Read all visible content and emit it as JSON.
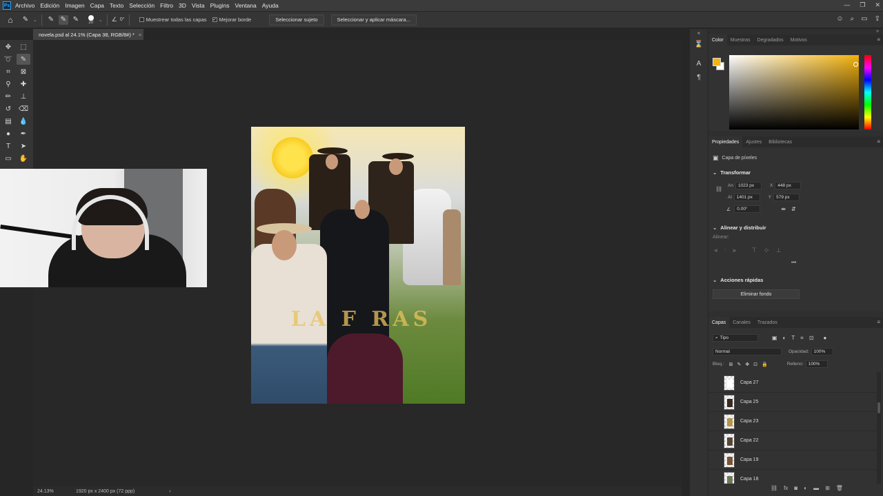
{
  "app": {
    "logo": "Ps"
  },
  "menu": [
    "Archivo",
    "Edición",
    "Imagen",
    "Capa",
    "Texto",
    "Selección",
    "Filtro",
    "3D",
    "Vista",
    "Plugins",
    "Ventana",
    "Ayuda"
  ],
  "window_controls": {
    "minimize": "—",
    "restore": "❐",
    "close": "✕"
  },
  "options": {
    "brush_size": "20",
    "angle": "0°",
    "sample_all_layers": "Muestrear todas las capas",
    "sample_all_layers_checked": false,
    "enhance_edge": "Mejorar borde",
    "enhance_edge_checked": true,
    "select_subject": "Seleccionar sujeto",
    "select_and_mask": "Seleccionar y aplicar máscara..."
  },
  "document_tab": {
    "title": "novela.psd al 24.1% (Capa 38, RGB/8#) *",
    "close": "×"
  },
  "artwork": {
    "visible_title_text": "LA  F  RAS"
  },
  "color_panel": {
    "tabs": [
      "Color",
      "Muestras",
      "Degradados",
      "Motivos"
    ],
    "foreground": "#f5b50f",
    "background": "#ffffff"
  },
  "properties_panel": {
    "tabs": [
      "Propiedades",
      "Ajustes",
      "Bibliotecas"
    ],
    "layer_type": "Capa de píxeles",
    "transform_heading": "Transformar",
    "width_label": "An",
    "width": "1023 px",
    "height_label": "Al",
    "height": "1401 px",
    "x_label": "X",
    "x": "448 px",
    "y_label": "Y",
    "y": "579 px",
    "angle": "0.00°",
    "align_heading": "Alinear y distribuir",
    "align_label": "Alinear:",
    "more": "•••",
    "quick_actions_heading": "Acciones rápidas",
    "remove_bg": "Eliminar fondo"
  },
  "layers_panel": {
    "tabs": [
      "Capas",
      "Canales",
      "Trazados"
    ],
    "filter_kind": "Tipo",
    "blend_mode": "Normal",
    "opacity_label": "Opacidad:",
    "opacity": "100%",
    "lock_label": "Bloq.:",
    "fill_label": "Relleno:",
    "fill": "100%",
    "layers": [
      {
        "name": "Capa 27",
        "thumb_color": "#ffffff"
      },
      {
        "name": "Capa 25",
        "thumb_color": "#3a2a22"
      },
      {
        "name": "Capa 23",
        "thumb_color": "#b3974a"
      },
      {
        "name": "Capa 22",
        "thumb_color": "#5a4634"
      },
      {
        "name": "Capa 19",
        "thumb_color": "#7a5436"
      },
      {
        "name": "Capa 18",
        "thumb_color": "#6f7a5a"
      }
    ]
  },
  "status": {
    "zoom": "24.13%",
    "doc_size": "1920 px x 2400 px (72 ppp)",
    "arrow": "›"
  }
}
